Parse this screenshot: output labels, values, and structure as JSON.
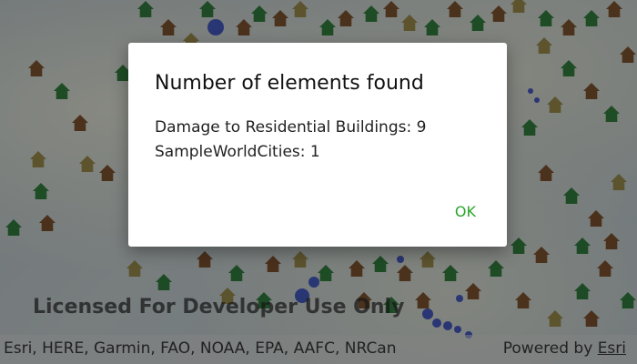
{
  "colors": {
    "accent_green": "#2aa52a",
    "marker_brown": "#6b3f1c",
    "marker_green": "#1e6b2a",
    "marker_olive": "#8a7a3a",
    "city_blue": "#2a3fb0",
    "scrim": "rgba(0,0,0,0.35)"
  },
  "map": {
    "watermark": "Licensed For Developer Use Only",
    "attribution": "Esri, HERE, Garmin, FAO, NOAA, EPA, AAFC, NRCan",
    "powered_by_prefix": "Powered by ",
    "powered_by_link": "Esri",
    "markers": {
      "house_icon": "house-icon",
      "city_icon": "circle-icon"
    }
  },
  "dialog": {
    "title": "Number of elements found",
    "lines": [
      "Damage to Residential Buildings: 9",
      "SampleWorldCities: 1"
    ],
    "ok_label": "OK"
  }
}
